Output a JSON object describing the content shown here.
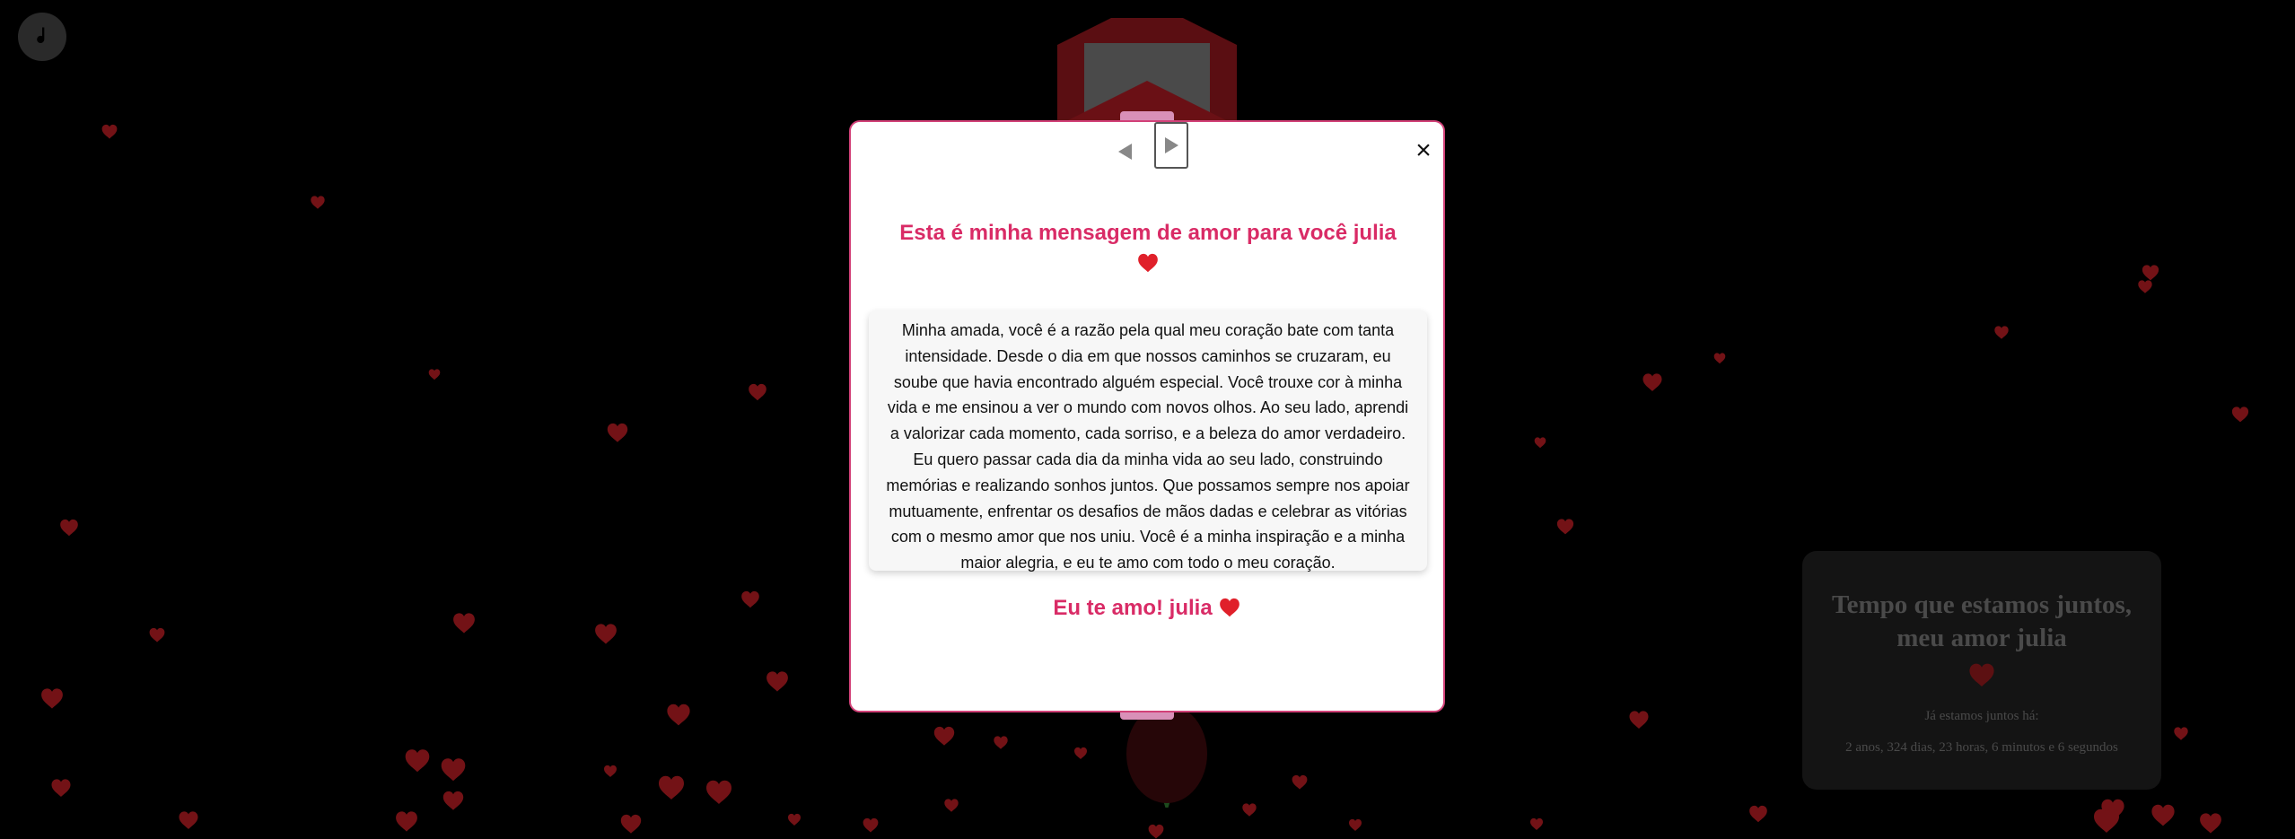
{
  "music_button": {
    "icon": "music-note-icon"
  },
  "modal": {
    "nav_prev_icon": "triangle-left-icon",
    "nav_next_icon": "triangle-right-icon",
    "close_label": "×",
    "title": "Esta é minha mensagem de amor para você julia",
    "message": "Minha amada, você é a razão pela qual meu coração bate com tanta intensidade. Desde o dia em que nossos caminhos se cruzaram, eu soube que havia encontrado alguém especial. Você trouxe cor à minha vida e me ensinou a ver o mundo com novos olhos. Ao seu lado, aprendi a valorizar cada momento, cada sorriso, e a beleza do amor verdadeiro. Eu quero passar cada dia da minha vida ao seu lado, construindo memórias e realizando sonhos juntos. Que possamos sempre nos apoiar mutuamente, enfrentar os desafios de mãos dadas e celebrar as vitórias com o mesmo amor que nos uniu. Você é a minha inspiração e a minha maior alegria, e eu te amo com todo o meu coração.",
    "closing": "Eu te amo! julia"
  },
  "timer": {
    "title": "Tempo que estamos juntos, meu amor julia",
    "subtitle": "Já estamos juntos há:",
    "value": "2 anos, 324 dias, 23 horas, 6 minutos e 6 segundos"
  },
  "colors": {
    "accent": "#d92b66",
    "modal_border": "#d24178",
    "heart": "#e0202a",
    "background": "#000000"
  }
}
